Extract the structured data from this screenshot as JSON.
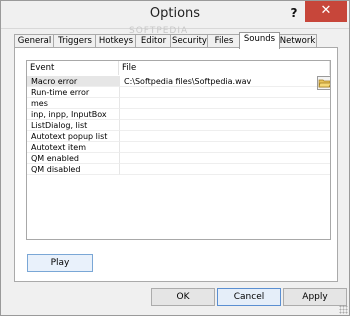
{
  "window": {
    "title": "Options",
    "help_label": "?",
    "close_label": "✕",
    "watermark": "SOFTPEDIA"
  },
  "tabs": [
    {
      "label": "General",
      "active": false
    },
    {
      "label": "Triggers",
      "active": false
    },
    {
      "label": "Hotkeys",
      "active": false
    },
    {
      "label": "Editor",
      "active": false
    },
    {
      "label": "Security",
      "active": false
    },
    {
      "label": "Files",
      "active": false
    },
    {
      "label": "Sounds",
      "active": true
    },
    {
      "label": "Network",
      "active": false
    }
  ],
  "grid": {
    "columns": {
      "event": "Event",
      "file": "File"
    },
    "rows": [
      {
        "event": "Macro error",
        "file": "C:\\Softpedia files\\Softpedia.wav",
        "selected": true
      },
      {
        "event": "Run-time error",
        "file": ""
      },
      {
        "event": "mes",
        "file": ""
      },
      {
        "event": "inp, inpp, InputBox",
        "file": ""
      },
      {
        "event": "ListDialog, list",
        "file": ""
      },
      {
        "event": "Autotext popup list",
        "file": ""
      },
      {
        "event": "Autotext item",
        "file": ""
      },
      {
        "event": "QM enabled",
        "file": ""
      },
      {
        "event": "QM disabled",
        "file": ""
      }
    ],
    "browse_icon": "folder-open-icon"
  },
  "play_label": "Play",
  "buttons": {
    "ok": "OK",
    "cancel": "Cancel",
    "apply": "Apply"
  },
  "colors": {
    "accent": "#5b8fd1",
    "close_red": "#c7463a"
  }
}
